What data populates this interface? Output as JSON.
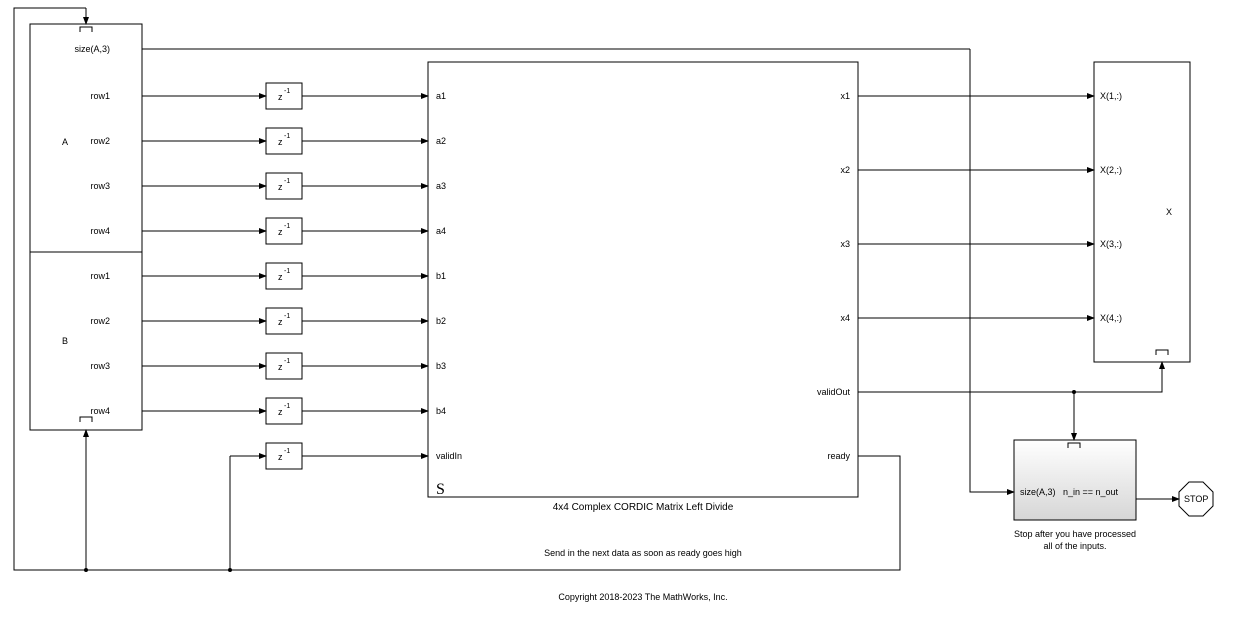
{
  "blocks": {
    "A": {
      "label": "A",
      "outputs": [
        "size(A,3)",
        "row1",
        "row2",
        "row3",
        "row4"
      ]
    },
    "B": {
      "label": "B",
      "outputs": [
        "row1",
        "row2",
        "row3",
        "row4"
      ]
    },
    "delay": {
      "base": "z",
      "exp": "-1"
    },
    "main": {
      "name": "4x4 Complex CORDIC Matrix Left Divide",
      "inputs": [
        "a1",
        "a2",
        "a3",
        "a4",
        "b1",
        "b2",
        "b3",
        "b4",
        "validIn"
      ],
      "outputs": [
        "x1",
        "x2",
        "x3",
        "x4",
        "validOut",
        "ready"
      ],
      "glyph": "S"
    },
    "X": {
      "label": "X",
      "inputs": [
        "X(1,:)",
        "X(2,:)",
        "X(3,:)",
        "X(4,:)"
      ]
    },
    "stop_chk": {
      "in": "size(A,3)",
      "text": "n_in == n_out"
    },
    "stop": {
      "label": "STOP"
    }
  },
  "annotations": {
    "ready_note": "Send in the next data as soon as ready goes high",
    "stop_note1": "Stop after you have processed",
    "stop_note2": "all of the inputs.",
    "copyright": "Copyright 2018-2023 The MathWorks, Inc."
  }
}
